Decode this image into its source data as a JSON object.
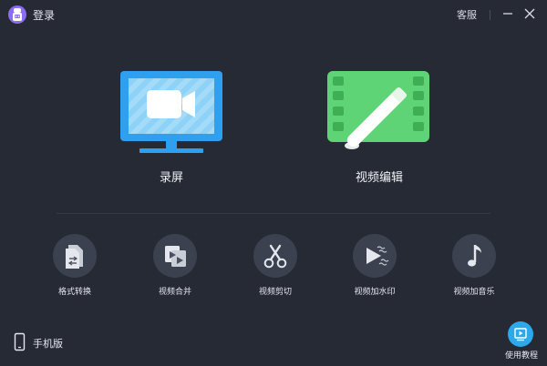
{
  "titlebar": {
    "login_label": "登录",
    "support_label": "客服",
    "avatar_icon": "user-robot-icon",
    "minimize_icon": "minimize-icon",
    "close_icon": "close-icon"
  },
  "main_features": [
    {
      "label": "录屏",
      "icon": "monitor-camera-icon",
      "color": "#2e9ef0"
    },
    {
      "label": "视频编辑",
      "icon": "film-pen-icon",
      "color": "#5fd476"
    }
  ],
  "tools": [
    {
      "label": "格式转换",
      "icon": "file-convert-icon"
    },
    {
      "label": "视频合并",
      "icon": "video-merge-icon"
    },
    {
      "label": "视频剪切",
      "icon": "scissors-icon"
    },
    {
      "label": "视频加水印",
      "icon": "play-watermark-icon"
    },
    {
      "label": "视频加音乐",
      "icon": "music-note-icon"
    }
  ],
  "footer": {
    "mobile_label": "手机版",
    "mobile_icon": "phone-icon",
    "tutorial_label": "使用教程",
    "tutorial_icon": "play-screen-icon"
  },
  "colors": {
    "background": "#262a35",
    "tool_circle": "#3c4150",
    "accent_blue": "#2da8ea",
    "accent_green": "#5fd476",
    "avatar": "#8b6cf5"
  }
}
